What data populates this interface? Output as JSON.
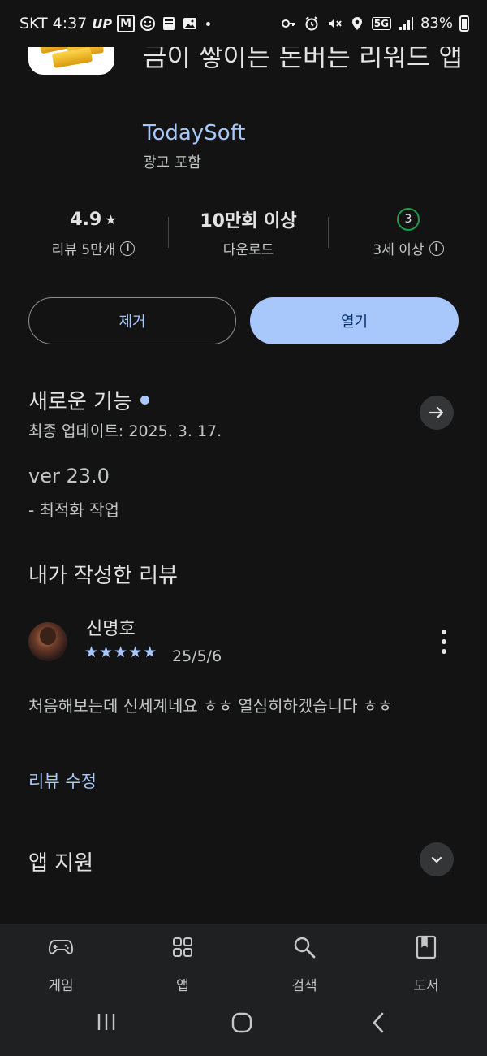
{
  "status_bar": {
    "carrier": "SKT",
    "time": "4:37",
    "up_badge": "UP",
    "m_badge": "M",
    "network": "5G",
    "battery": "83%"
  },
  "app": {
    "title": "금이 쌓이는 돈버는 리워드 앱",
    "developer": "TodaySoft",
    "ads_label": "광고 포함"
  },
  "stats": {
    "rating": "4.9",
    "rating_star": "★",
    "reviews_label": "리뷰 5만개",
    "downloads": "10만회 이상",
    "downloads_label": "다운로드",
    "age_badge": "3",
    "age_label": "3세 이상"
  },
  "actions": {
    "remove_label": "제거",
    "open_label": "열기"
  },
  "whats_new": {
    "title": "새로운 기능",
    "updated": "최종 업데이트: 2025. 3. 17.",
    "version": "ver 23.0",
    "note": "- 최적화 작업"
  },
  "my_review": {
    "section_title": "내가 작성한 리뷰",
    "reviewer": "신명호",
    "stars": "★★★★★",
    "star_count": 5,
    "date": "25/5/6",
    "text": "처음해보는데 신세계네요 ㅎㅎ 열심히하겠습니다 ㅎㅎ",
    "edit_label": "리뷰 수정"
  },
  "app_support": {
    "title": "앱 지원"
  },
  "bottom_nav": {
    "items": [
      {
        "label": "게임",
        "icon": "gamepad-icon"
      },
      {
        "label": "앱",
        "icon": "apps-grid-icon"
      },
      {
        "label": "검색",
        "icon": "search-icon"
      },
      {
        "label": "도서",
        "icon": "book-icon"
      }
    ]
  },
  "colors": {
    "background": "#131313",
    "accent": "#a8c7fa",
    "open_button": "#a8c7fa",
    "text_primary": "#e3e3e3",
    "text_secondary": "#c4c7c5",
    "nav_background": "#1f2022"
  }
}
